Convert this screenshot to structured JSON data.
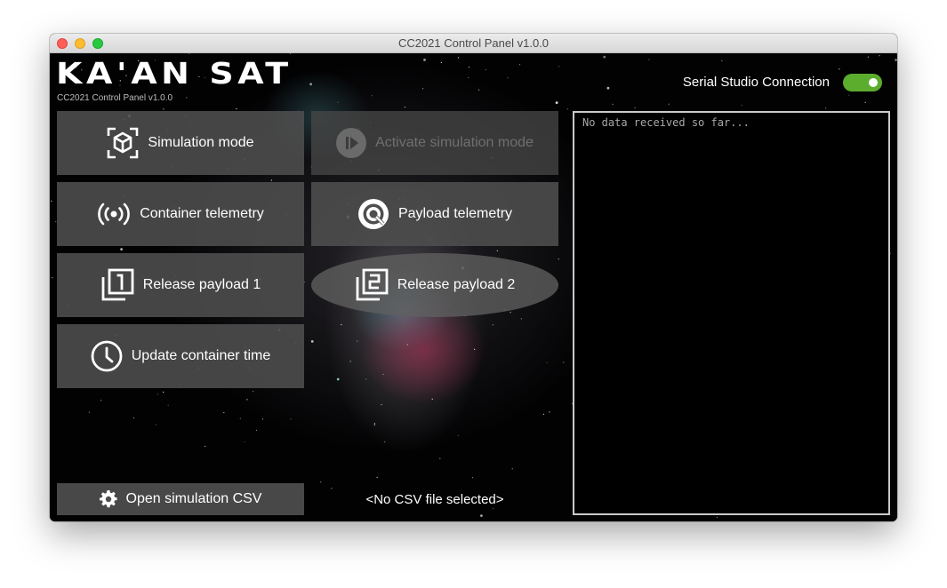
{
  "window": {
    "title": "CC2021 Control Panel v1.0.0"
  },
  "header": {
    "logo_text": "KA'AN SAT",
    "subtitle": "CC2021 Control Panel v1.0.0",
    "connection_label": "Serial Studio Connection",
    "connection_enabled": true,
    "toggle_color": "#5cac2e"
  },
  "buttons": {
    "simulation_mode": {
      "label": "Simulation mode",
      "icon": "cube-scan-icon"
    },
    "activate_simulation": {
      "label": "Activate simulation mode",
      "icon": "play-circle-icon",
      "enabled": false
    },
    "container_telemetry": {
      "label": "Container telemetry",
      "icon": "broadcast-icon"
    },
    "payload_telemetry": {
      "label": "Payload telemetry",
      "icon": "target-icon"
    },
    "release_payload_1": {
      "label": "Release payload 1",
      "icon": "filter-1-icon"
    },
    "release_payload_2": {
      "label": "Release payload 2",
      "icon": "filter-2-icon"
    },
    "update_container_time": {
      "label": "Update container time",
      "icon": "clock-icon"
    }
  },
  "csv": {
    "open_label": "Open simulation CSV",
    "icon": "gear-icon",
    "status": "<No CSV file selected>"
  },
  "console": {
    "text": "No data received so far..."
  }
}
